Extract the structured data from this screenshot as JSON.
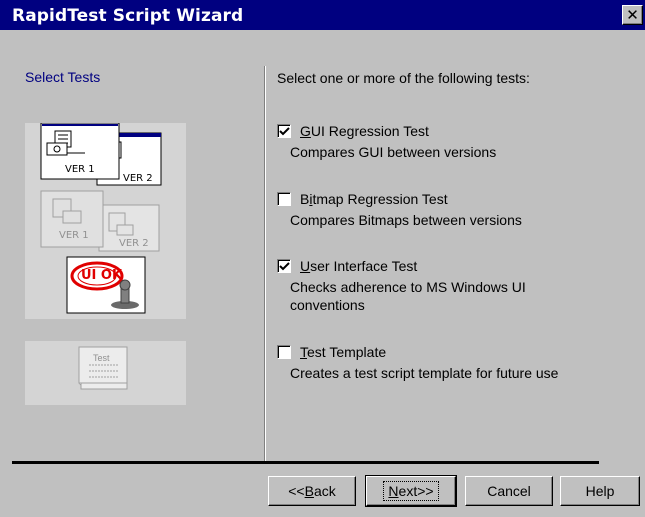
{
  "window": {
    "title": "RapidTest Script Wizard",
    "close_glyph": "✕"
  },
  "left_panel": {
    "header": "Select Tests",
    "images": [
      {
        "name": "gui-regression-image",
        "labels": [
          "VER 1",
          "VER 2"
        ]
      },
      {
        "name": "bitmap-regression-image",
        "labels": [
          "VER 1",
          "VER 2"
        ]
      },
      {
        "name": "ui-test-image",
        "label": "UI OK"
      },
      {
        "name": "test-template-image",
        "label": "Test"
      }
    ]
  },
  "instruction": "Select one or more of the following tests:",
  "options": [
    {
      "label": "GUI Regression Test",
      "description": "Compares GUI between versions",
      "checked": true
    },
    {
      "label": "Bitmap Regression Test",
      "description": "Compares Bitmaps between versions",
      "checked": false
    },
    {
      "label": "User Interface Test",
      "description": "Checks adherence to MS Windows UI conventions",
      "checked": true
    },
    {
      "label": "Test Template",
      "description": "Creates a test script template for future use",
      "checked": false
    }
  ],
  "buttons": {
    "back": "<<Back",
    "next": "Next>>",
    "cancel": "Cancel",
    "help": "Help"
  },
  "colors": {
    "titlebar": "#000080",
    "face": "#c0c0c0",
    "header_text": "#000080"
  }
}
